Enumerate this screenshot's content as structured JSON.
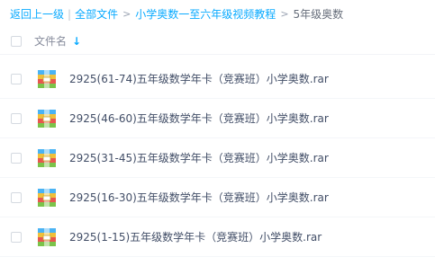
{
  "breadcrumb": {
    "back_label": "返回上一级",
    "separator": "|",
    "all_files_label": "全部文件",
    "arrow": ">",
    "level1_label": "小学奥数一至六年级视频教程",
    "current_label": "5年级奥数"
  },
  "list_header": {
    "name_label": "文件名",
    "sort_icon": "arrow-down-icon"
  },
  "files": [
    {
      "name": "2925(61-74)五年级数学年卡（竞赛班）小学奥数.rar",
      "icon": "rar-archive-icon"
    },
    {
      "name": "2925(46-60)五年级数学年卡（竞赛班）小学奥数.rar",
      "icon": "rar-archive-icon"
    },
    {
      "name": "2925(31-45)五年级数学年卡（竞赛班）小学奥数.rar",
      "icon": "rar-archive-icon"
    },
    {
      "name": "2925(16-30)五年级数学年卡（竞赛班）小学奥数.rar",
      "icon": "rar-archive-icon"
    },
    {
      "name": "2925(1-15)五年级数学年卡（竞赛班）小学奥数.rar",
      "icon": "rar-archive-icon"
    }
  ],
  "colors": {
    "link": "#09aaff",
    "text": "#424e67",
    "header_text": "#878c9c"
  }
}
